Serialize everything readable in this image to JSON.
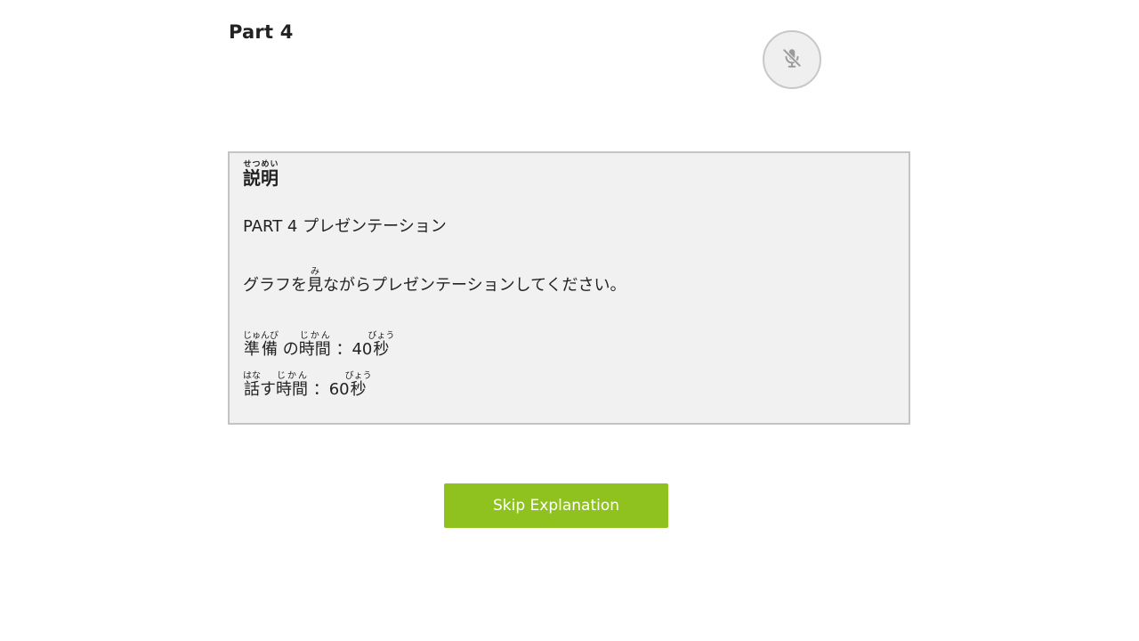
{
  "header": {
    "part_title": "Part 4"
  },
  "mic": {
    "icon": "microphone-off-icon",
    "state": "muted"
  },
  "explanation": {
    "heading": {
      "base": "説明",
      "reading": "せつめい"
    },
    "title": "PART 4 プレゼンテーション",
    "instruction": {
      "before": "グラフを",
      "kanji": "見",
      "kanji_reading": "み",
      "after": "ながらプレゼンテーションしてください。"
    },
    "prep_time": {
      "w1": "準備",
      "w1_reading": "じゅんび",
      "p1": "の",
      "w2": "時間",
      "w2_reading": "じかん",
      "sep": "：",
      "num": "40",
      "w3": "秒",
      "w3_reading": "びょう"
    },
    "speak_time": {
      "w1": "話",
      "w1_reading": "はな",
      "p1": "す",
      "w2": "時間",
      "w2_reading": "じかん",
      "sep": "：",
      "num": "60",
      "w3": "秒",
      "w3_reading": "びょう"
    }
  },
  "actions": {
    "skip_label": "Skip Explanation",
    "skip_color": "#8fc21f"
  }
}
